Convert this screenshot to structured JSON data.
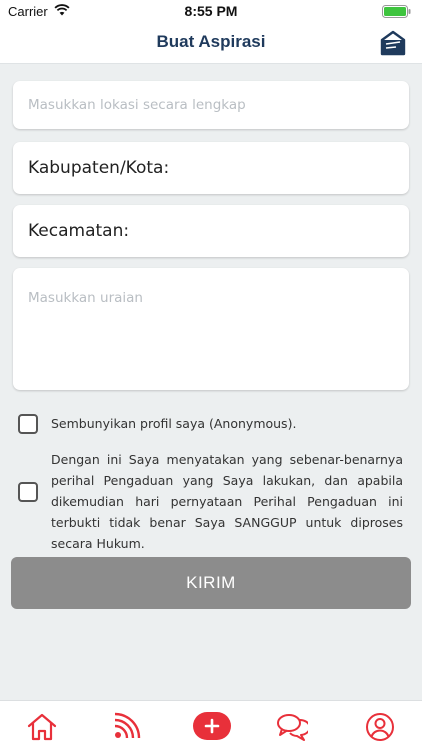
{
  "status_bar": {
    "carrier": "Carrier",
    "time": "8:55 PM"
  },
  "nav": {
    "title": "Buat Aspirasi",
    "action_icon": "message-box-icon"
  },
  "form": {
    "lokasi_placeholder": "Masukkan lokasi secara lengkap",
    "kabupaten_label": "Kabupaten/Kota:",
    "kecamatan_label": "Kecamatan:",
    "uraian_placeholder": "Masukkan uraian",
    "anonymous_label": "Sembunyikan profil saya (Anonymous).",
    "agreement_text": "Dengan ini Saya menyatakan yang sebenar-benarnya perihal Pengaduan yang Saya lakukan, dan apabila dikemudian hari pernyataan Perihal Pengaduan ini terbukti tidak benar Saya SANGGUP untuk diproses secara Hukum.",
    "submit_label": "KIRIM"
  },
  "colors": {
    "accent": "#e8303a",
    "title": "#1f3a5c",
    "button_disabled": "#8c8c8c"
  },
  "tabs": [
    {
      "icon": "home-icon"
    },
    {
      "icon": "feed-icon"
    },
    {
      "icon": "add-icon"
    },
    {
      "icon": "chat-icon"
    },
    {
      "icon": "profile-icon"
    }
  ]
}
